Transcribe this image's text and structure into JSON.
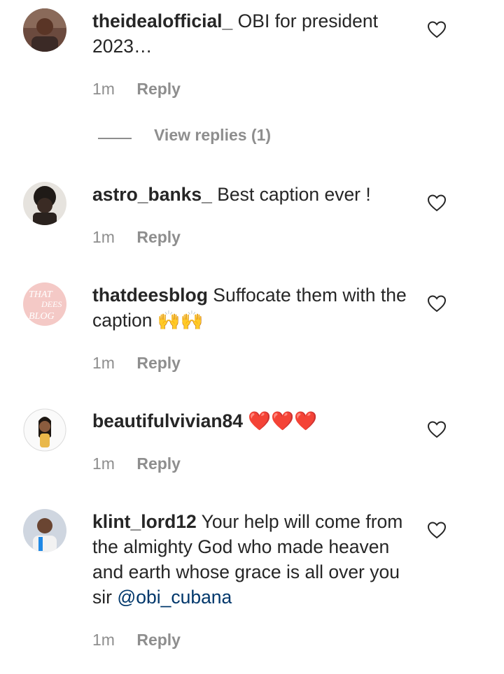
{
  "comments": [
    {
      "username": "theidealofficial_",
      "text": "OBI for president 2023…",
      "time": "1m",
      "reply_label": "Reply",
      "avatar_icon": "user-photo-avatar",
      "like_icon": "heart-outline-icon"
    },
    {
      "username": "astro_banks_",
      "text": "Best caption ever !",
      "time": "1m",
      "reply_label": "Reply",
      "avatar_icon": "user-photo-avatar",
      "like_icon": "heart-outline-icon"
    },
    {
      "username": "thatdeesblog",
      "text": "Suffocate them with the caption 🙌🙌",
      "time": "1m",
      "reply_label": "Reply",
      "avatar_icon": "blog-logo-avatar",
      "avatar_logo_text": [
        "THAT",
        "DEES",
        "BLOG"
      ],
      "like_icon": "heart-outline-icon"
    },
    {
      "username": "beautifulvivian84",
      "text": "❤️❤️❤️",
      "time": "1m",
      "reply_label": "Reply",
      "avatar_icon": "user-photo-avatar",
      "like_icon": "heart-outline-icon"
    },
    {
      "username": "klint_lord12",
      "text": "Your help will come from the almighty God who made heaven and earth whose grace is all over you sir",
      "mention": "@obi_cubana",
      "time": "1m",
      "reply_label": "Reply",
      "avatar_icon": "user-photo-avatar",
      "like_icon": "heart-outline-icon"
    }
  ],
  "view_replies": {
    "label": "View replies (1)"
  },
  "colors": {
    "text": "#262626",
    "secondary": "#8e8e8e",
    "mention": "#00376b",
    "background": "#ffffff"
  }
}
